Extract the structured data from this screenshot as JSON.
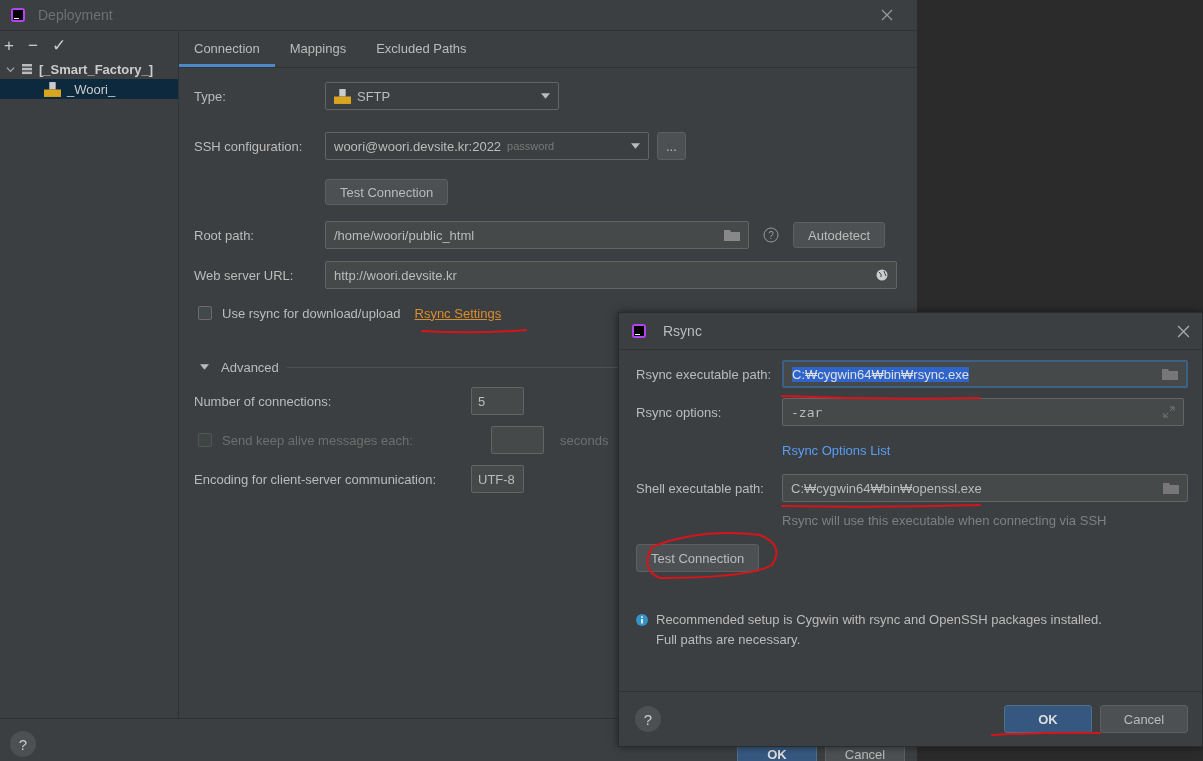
{
  "window": {
    "title": "Deployment",
    "help": "?"
  },
  "toolbar": [
    "+",
    "−",
    "✓"
  ],
  "tree": [
    {
      "label": "[_Smart_Factory_]",
      "expanded": true,
      "selected": false,
      "children": [
        {
          "label": "_Woori_",
          "selected": true
        }
      ]
    }
  ],
  "tabs": [
    {
      "label": "Connection",
      "selected": true
    },
    {
      "label": "Mappings",
      "selected": false
    },
    {
      "label": "Excluded Paths",
      "selected": false
    }
  ],
  "form": {
    "type": {
      "label": "Type:",
      "value": "SFTP"
    },
    "ssh": {
      "label": "SSH configuration:",
      "value": "woori@woori.devsite.kr:2022",
      "hint": "password",
      "more": "..."
    },
    "test_button": "Test Connection",
    "root_path": {
      "label": "Root path:",
      "value": "/home/woori/public_html",
      "button": "Autodetect",
      "help": "?"
    },
    "web_url": {
      "label": "Web server URL:",
      "value": "http://woori.devsite.kr"
    },
    "rsync": {
      "label": "Use rsync for download/upload",
      "checked": false,
      "link": "Rsync Settings"
    },
    "advanced": {
      "label": "Advanced",
      "expanded": true
    },
    "connections": {
      "label": "Number of connections:",
      "value": "5"
    },
    "keep_alive": {
      "label": "Send keep alive messages each:",
      "checked": false,
      "disabled": true,
      "unit": "seconds"
    },
    "encoding": {
      "label": "Encoding for client-server communication:",
      "value": "UTF-8"
    }
  },
  "buttons": [
    "OK",
    "Cancel"
  ],
  "rsync_dialog": {
    "title": "Rsync",
    "fields": [
      {
        "kind": "path",
        "label": "Rsync executable path:",
        "value": "C:₩cygwin64₩bin₩rsync.exe",
        "focused": true
      },
      {
        "kind": "expand",
        "label": "Rsync options:",
        "value": "-zar",
        "focused": false
      },
      {
        "kind": "link",
        "label": "Rsync Options List"
      },
      {
        "kind": "path",
        "label": "Shell executable path:",
        "value": "C:₩cygwin64₩bin₩openssl.exe",
        "focused": false,
        "hint": "Rsync will use this executable when connecting via SSH"
      }
    ],
    "test_button": "Test Connection",
    "help": "?",
    "info": [
      "Recommended setup is Cygwin with rsync and OpenSSH packages installed.",
      "Full paths are necessary."
    ],
    "buttons": [
      {
        "label": "OK",
        "default": true
      },
      {
        "label": "Cancel",
        "default": false
      }
    ]
  }
}
